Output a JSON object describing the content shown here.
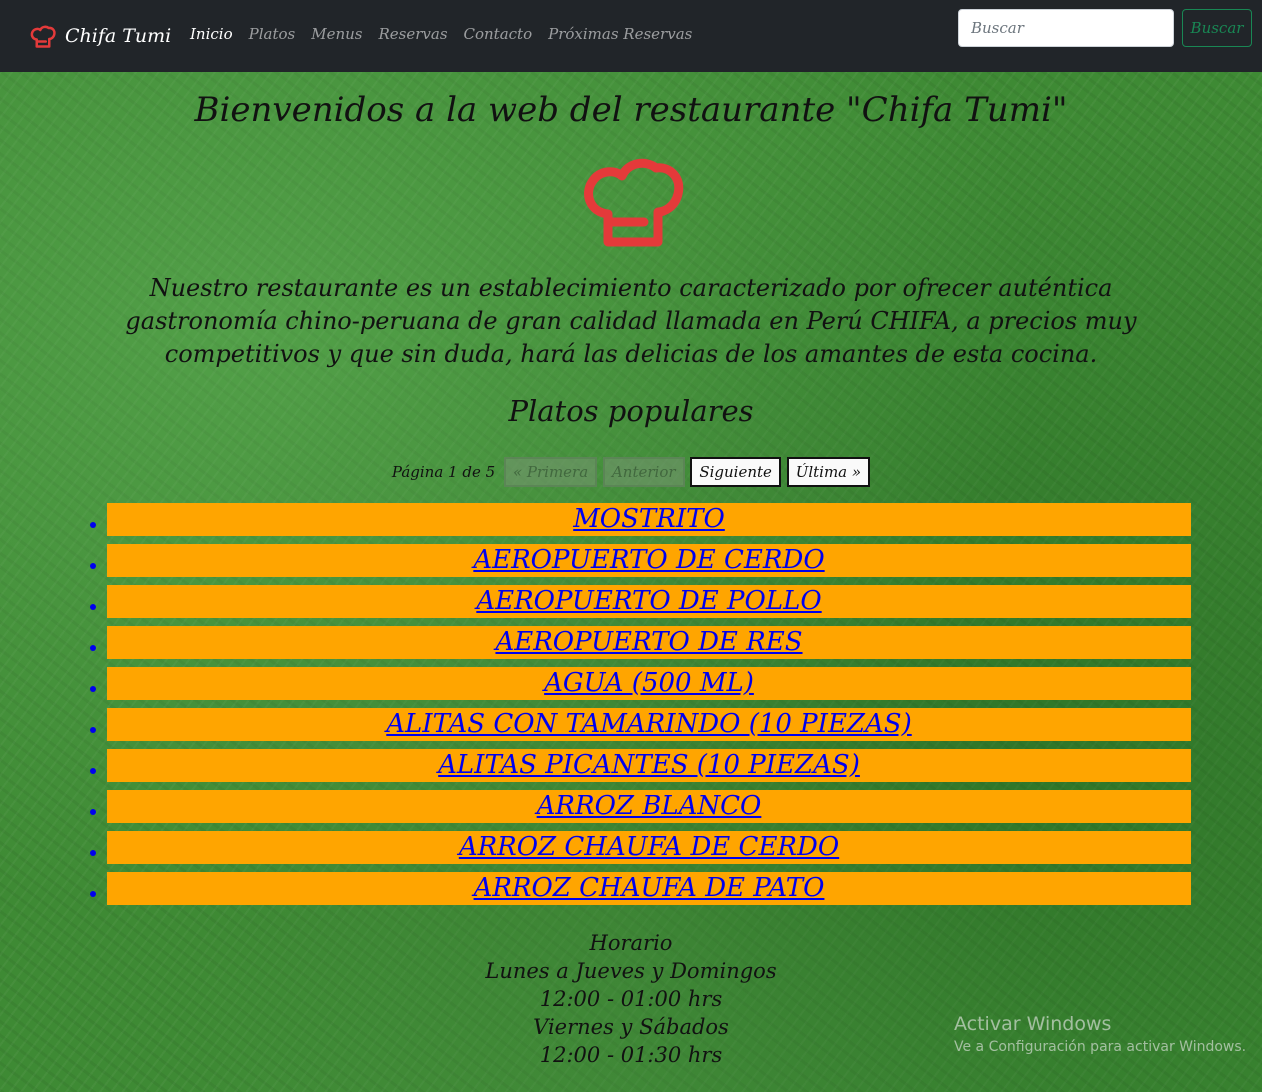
{
  "navbar": {
    "brand": "Chifa Tumi",
    "links": [
      "Inicio",
      "Platos",
      "Menus",
      "Reservas",
      "Contacto",
      "Próximas Reservas"
    ],
    "active": "Inicio",
    "search_placeholder": "Buscar",
    "search_button": "Buscar"
  },
  "colors": {
    "navbar_bg": "#212529",
    "accent_hat": "#e43a3a",
    "dish_bg": "#ffa500",
    "link": "#0000ee",
    "search_button": "#198754"
  },
  "main": {
    "welcome": "Bienvenidos a la web del restaurante \"Chifa Tumi\"",
    "intro": "Nuestro restaurante es un establecimiento caracterizado por ofrecer auténtica gastronomía chino-peruana de gran calidad llamada en Perú CHIFA, a precios muy competitivos y que sin duda, hará las delicias de los amantes de esta cocina.",
    "popular_title": "Platos populares"
  },
  "pagination": {
    "label": "Página 1 de 5",
    "first": "« Primera",
    "prev": "Anterior",
    "next": "Siguiente",
    "last": "Última »"
  },
  "dishes": [
    "MOSTRITO",
    "AEROPUERTO DE CERDO",
    "AEROPUERTO DE POLLO",
    "AEROPUERTO DE RES",
    "AGUA (500 ML)",
    "ALITAS CON TAMARINDO (10 PIEZAS)",
    "ALITAS PICANTES (10 PIEZAS)",
    "ARROZ BLANCO",
    "ARROZ CHAUFA DE CERDO",
    "ARROZ CHAUFA DE PATO"
  ],
  "hours": {
    "title": "Horario",
    "line1": "Lunes a Jueves y Domingos",
    "line2": "12:00 - 01:00 hrs",
    "line3": "Viernes y Sábados",
    "line4": "12:00 - 01:30 hrs"
  },
  "watermark": {
    "title": "Activar Windows",
    "subtitle": "Ve a Configuración para activar Windows."
  }
}
